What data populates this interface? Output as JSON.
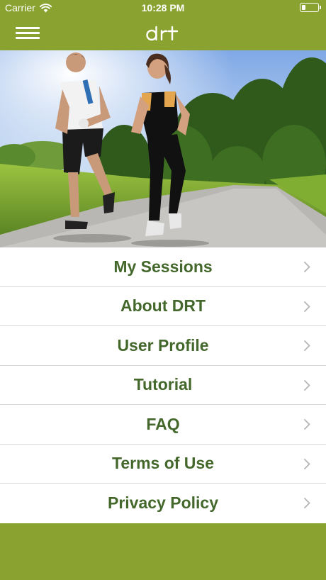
{
  "status_bar": {
    "carrier": "Carrier",
    "time": "10:28 PM",
    "battery_level": 0.25
  },
  "header": {
    "logo_text": "drt",
    "menu_icon": "hamburger-icon"
  },
  "hero": {
    "image": "couple-jogging-on-park-road"
  },
  "menu": {
    "items": [
      {
        "label": "My Sessions"
      },
      {
        "label": "About DRT"
      },
      {
        "label": "User Profile"
      },
      {
        "label": "Tutorial"
      },
      {
        "label": "FAQ"
      },
      {
        "label": "Terms of Use"
      },
      {
        "label": "Privacy Policy"
      }
    ],
    "chevron_icon": "chevron-right-icon"
  },
  "colors": {
    "brand_green": "#8aa22f",
    "label_green": "#44682c",
    "divider": "#d8d8d8"
  }
}
